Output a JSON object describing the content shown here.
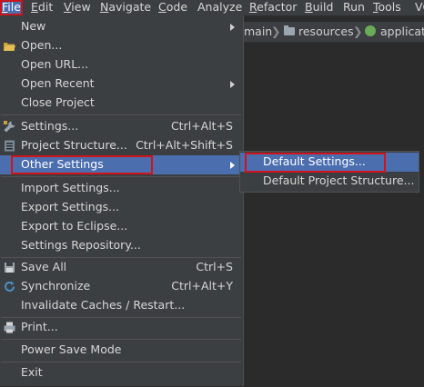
{
  "menubar": {
    "items": [
      {
        "label": "File",
        "mnemonic": "F",
        "rest": "ile"
      },
      {
        "label": "Edit",
        "mnemonic": "E",
        "rest": "dit"
      },
      {
        "label": "View",
        "mnemonic": "V",
        "rest": "iew"
      },
      {
        "label": "Navigate",
        "mnemonic": "N",
        "rest": "avigate"
      },
      {
        "label": "Code",
        "mnemonic": "C",
        "rest": "ode"
      },
      {
        "label": "Analyze",
        "mnemonic": "",
        "rest": "Analyze"
      },
      {
        "label": "Refactor",
        "mnemonic": "R",
        "rest": "efactor"
      },
      {
        "label": "Build",
        "mnemonic": "B",
        "rest": "uild"
      },
      {
        "label": "Run",
        "mnemonic": "",
        "rest": "Run"
      },
      {
        "label": "Tools",
        "mnemonic": "T",
        "rest": "ools"
      },
      {
        "label": "VC",
        "mnemonic": "",
        "rest": "VC"
      }
    ]
  },
  "breadcrumb": {
    "items": [
      "main",
      "resources",
      "applicati"
    ],
    "separator": "❯"
  },
  "file_menu": {
    "new": "New",
    "open": "Open...",
    "open_url": "Open URL...",
    "open_recent": "Open Recent",
    "close_project": "Close Project",
    "settings": "Settings...",
    "settings_shortcut": "Ctrl+Alt+S",
    "project_structure": "Project Structure...",
    "project_structure_shortcut": "Ctrl+Alt+Shift+S",
    "other_settings": "Other Settings",
    "import_settings": "Import Settings...",
    "export_settings": "Export Settings...",
    "export_eclipse": "Export to Eclipse...",
    "settings_repository": "Settings Repository...",
    "save_all": "Save All",
    "save_all_shortcut": "Ctrl+S",
    "synchronize": "Synchronize",
    "synchronize_shortcut": "Ctrl+Alt+Y",
    "invalidate_caches": "Invalidate Caches / Restart...",
    "print": "Print...",
    "power_save_mode": "Power Save Mode",
    "exit": "Exit"
  },
  "other_settings_submenu": {
    "default_settings": "Default Settings...",
    "default_project_structure": "Default Project Structure..."
  },
  "colors": {
    "menu_bg": "#3c3f41",
    "highlight": "#4b6eaf",
    "annotation_red": "#d0141c",
    "editor_bg": "#2b2b2b"
  }
}
